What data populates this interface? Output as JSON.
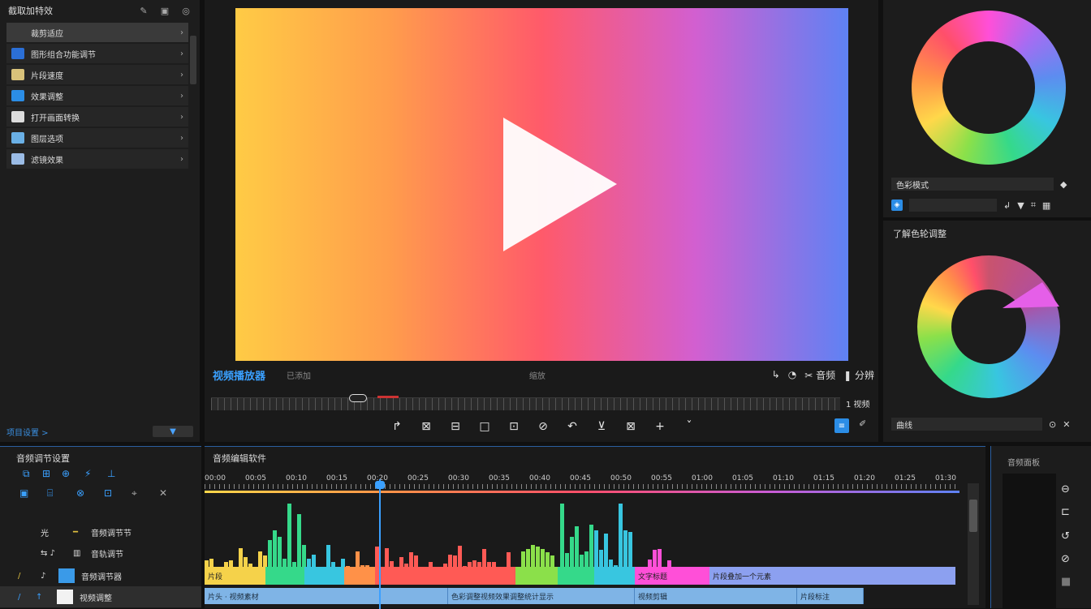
{
  "left_panel": {
    "title": "截取加特效",
    "items": [
      {
        "label": "裁剪适应",
        "color": "#3a3a3a",
        "selected": true
      },
      {
        "label": "图形组合功能调节",
        "color": "#2b6fd6"
      },
      {
        "label": "片段速度",
        "color": "#d9c27a"
      },
      {
        "label": "效果调整",
        "color": "#2b8de6"
      },
      {
        "label": "打开画面转换",
        "color": "#dddddd"
      },
      {
        "label": "图层选项",
        "color": "#6ab0e6"
      },
      {
        "label": "滤镜效果",
        "color": "#9bbce6"
      }
    ],
    "footer_label": "项目设置 >",
    "footer_button": "▼"
  },
  "viewer": {
    "timecode": "视频播放器",
    "sub_label": "已添加",
    "center_label": "缩放",
    "right_labels": [
      "↳",
      "◔",
      "✂ 音频",
      "❚ 分辨"
    ],
    "scrub_end": "1 视频",
    "tools": [
      "↱",
      "⊠",
      "⊟",
      "□",
      "⊡",
      "⊘",
      "↶",
      "⊻",
      "⊠",
      "+",
      "ˇ"
    ],
    "gradient": [
      "#ffcb45",
      "#ff5a6a",
      "#5e82f4"
    ]
  },
  "right_panel": {
    "field1": "色彩模式",
    "field2": "",
    "title2": "了解色轮调整",
    "field3": "曲线",
    "field3_right": "⊙"
  },
  "timeline_left": {
    "title": "音频调节设置",
    "tracks": [
      {
        "icon": "光",
        "label": "音频调节节"
      },
      {
        "icon": "⇆ ♪",
        "label": "音轨调节"
      },
      {
        "icon": "♪",
        "label": "音频调节器"
      },
      {
        "icon": "↑",
        "label": "视频调整"
      }
    ]
  },
  "timeline_main": {
    "title": "音频编辑软件",
    "ruler_labels": [
      "00:00",
      "00:05",
      "00:10",
      "00:15",
      "00:20",
      "00:25",
      "00:30",
      "00:35",
      "00:40",
      "00:45",
      "00:50",
      "00:55",
      "01:00",
      "01:05",
      "01:10",
      "01:15",
      "01:20",
      "01:25",
      "01:30"
    ],
    "clips_top": [
      "片段",
      "",
      "",
      "",
      "",
      "",
      "",
      "",
      "",
      "文字标题",
      "片段叠加一个元素"
    ],
    "clips_bottom": [
      "片头 · 视频素材",
      "色彩调整视频效果调整统计显示",
      "视频剪辑",
      "片段标注"
    ]
  },
  "tl_right": {
    "title": "音频面板"
  }
}
